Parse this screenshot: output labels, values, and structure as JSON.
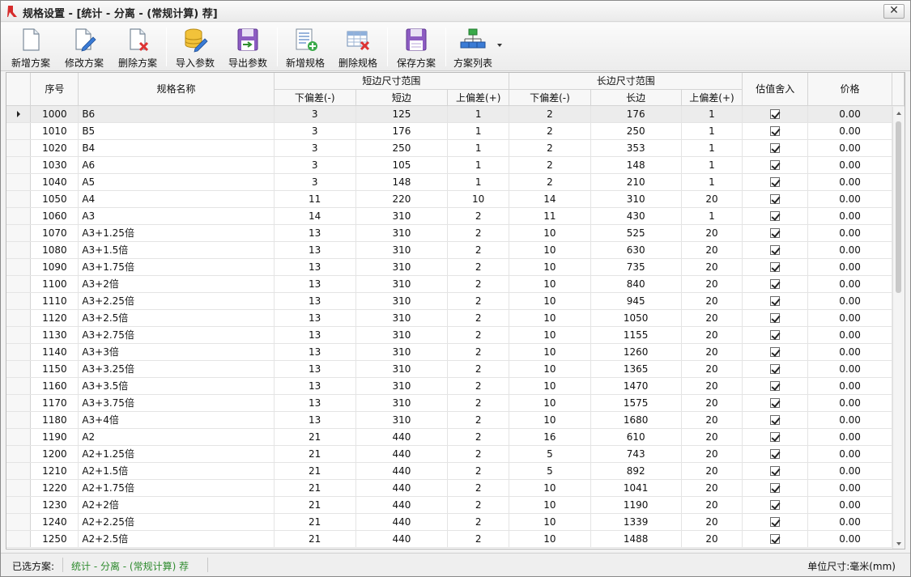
{
  "window": {
    "title": "规格设置 - [统计 - 分离 - (常规计算) 荐]",
    "close_glyph": "✕"
  },
  "toolbar": {
    "buttons": [
      {
        "label": "新增方案",
        "icon": "new-document-icon"
      },
      {
        "label": "修改方案",
        "icon": "edit-document-icon"
      },
      {
        "label": "删除方案",
        "icon": "delete-document-icon"
      },
      {
        "label": "导入参数",
        "icon": "database-import-icon"
      },
      {
        "label": "导出参数",
        "icon": "floppy-export-icon"
      },
      {
        "label": "新增规格",
        "icon": "add-spec-icon"
      },
      {
        "label": "删除规格",
        "icon": "delete-spec-icon"
      },
      {
        "label": "保存方案",
        "icon": "save-icon"
      },
      {
        "label": "方案列表",
        "icon": "hierarchy-list-icon"
      }
    ]
  },
  "grid": {
    "headers": {
      "seq": "序号",
      "name": "规格名称",
      "short_group": "短边尺寸范围",
      "long_group": "长边尺寸范围",
      "round": "估值舍入",
      "price": "价格",
      "lower": "下偏差(-)",
      "short": "短边",
      "long": "长边",
      "upper": "上偏差(+)"
    },
    "rows": [
      {
        "seq": "1000",
        "name": "B6",
        "s_low": "3",
        "s_val": "125",
        "s_up": "1",
        "l_low": "2",
        "l_val": "176",
        "l_up": "1",
        "round": true,
        "price": "0.00"
      },
      {
        "seq": "1010",
        "name": "B5",
        "s_low": "3",
        "s_val": "176",
        "s_up": "1",
        "l_low": "2",
        "l_val": "250",
        "l_up": "1",
        "round": true,
        "price": "0.00"
      },
      {
        "seq": "1020",
        "name": "B4",
        "s_low": "3",
        "s_val": "250",
        "s_up": "1",
        "l_low": "2",
        "l_val": "353",
        "l_up": "1",
        "round": true,
        "price": "0.00"
      },
      {
        "seq": "1030",
        "name": "A6",
        "s_low": "3",
        "s_val": "105",
        "s_up": "1",
        "l_low": "2",
        "l_val": "148",
        "l_up": "1",
        "round": true,
        "price": "0.00"
      },
      {
        "seq": "1040",
        "name": "A5",
        "s_low": "3",
        "s_val": "148",
        "s_up": "1",
        "l_low": "2",
        "l_val": "210",
        "l_up": "1",
        "round": true,
        "price": "0.00"
      },
      {
        "seq": "1050",
        "name": "A4",
        "s_low": "11",
        "s_val": "220",
        "s_up": "10",
        "l_low": "14",
        "l_val": "310",
        "l_up": "20",
        "round": true,
        "price": "0.00"
      },
      {
        "seq": "1060",
        "name": "A3",
        "s_low": "14",
        "s_val": "310",
        "s_up": "2",
        "l_low": "11",
        "l_val": "430",
        "l_up": "1",
        "round": true,
        "price": "0.00"
      },
      {
        "seq": "1070",
        "name": "A3+1.25倍",
        "s_low": "13",
        "s_val": "310",
        "s_up": "2",
        "l_low": "10",
        "l_val": "525",
        "l_up": "20",
        "round": true,
        "price": "0.00"
      },
      {
        "seq": "1080",
        "name": "A3+1.5倍",
        "s_low": "13",
        "s_val": "310",
        "s_up": "2",
        "l_low": "10",
        "l_val": "630",
        "l_up": "20",
        "round": true,
        "price": "0.00"
      },
      {
        "seq": "1090",
        "name": "A3+1.75倍",
        "s_low": "13",
        "s_val": "310",
        "s_up": "2",
        "l_low": "10",
        "l_val": "735",
        "l_up": "20",
        "round": true,
        "price": "0.00"
      },
      {
        "seq": "1100",
        "name": "A3+2倍",
        "s_low": "13",
        "s_val": "310",
        "s_up": "2",
        "l_low": "10",
        "l_val": "840",
        "l_up": "20",
        "round": true,
        "price": "0.00"
      },
      {
        "seq": "1110",
        "name": "A3+2.25倍",
        "s_low": "13",
        "s_val": "310",
        "s_up": "2",
        "l_low": "10",
        "l_val": "945",
        "l_up": "20",
        "round": true,
        "price": "0.00"
      },
      {
        "seq": "1120",
        "name": "A3+2.5倍",
        "s_low": "13",
        "s_val": "310",
        "s_up": "2",
        "l_low": "10",
        "l_val": "1050",
        "l_up": "20",
        "round": true,
        "price": "0.00"
      },
      {
        "seq": "1130",
        "name": "A3+2.75倍",
        "s_low": "13",
        "s_val": "310",
        "s_up": "2",
        "l_low": "10",
        "l_val": "1155",
        "l_up": "20",
        "round": true,
        "price": "0.00"
      },
      {
        "seq": "1140",
        "name": "A3+3倍",
        "s_low": "13",
        "s_val": "310",
        "s_up": "2",
        "l_low": "10",
        "l_val": "1260",
        "l_up": "20",
        "round": true,
        "price": "0.00"
      },
      {
        "seq": "1150",
        "name": "A3+3.25倍",
        "s_low": "13",
        "s_val": "310",
        "s_up": "2",
        "l_low": "10",
        "l_val": "1365",
        "l_up": "20",
        "round": true,
        "price": "0.00"
      },
      {
        "seq": "1160",
        "name": "A3+3.5倍",
        "s_low": "13",
        "s_val": "310",
        "s_up": "2",
        "l_low": "10",
        "l_val": "1470",
        "l_up": "20",
        "round": true,
        "price": "0.00"
      },
      {
        "seq": "1170",
        "name": "A3+3.75倍",
        "s_low": "13",
        "s_val": "310",
        "s_up": "2",
        "l_low": "10",
        "l_val": "1575",
        "l_up": "20",
        "round": true,
        "price": "0.00"
      },
      {
        "seq": "1180",
        "name": "A3+4倍",
        "s_low": "13",
        "s_val": "310",
        "s_up": "2",
        "l_low": "10",
        "l_val": "1680",
        "l_up": "20",
        "round": true,
        "price": "0.00"
      },
      {
        "seq": "1190",
        "name": "A2",
        "s_low": "21",
        "s_val": "440",
        "s_up": "2",
        "l_low": "16",
        "l_val": "610",
        "l_up": "20",
        "round": true,
        "price": "0.00"
      },
      {
        "seq": "1200",
        "name": "A2+1.25倍",
        "s_low": "21",
        "s_val": "440",
        "s_up": "2",
        "l_low": "5",
        "l_val": "743",
        "l_up": "20",
        "round": true,
        "price": "0.00"
      },
      {
        "seq": "1210",
        "name": "A2+1.5倍",
        "s_low": "21",
        "s_val": "440",
        "s_up": "2",
        "l_low": "5",
        "l_val": "892",
        "l_up": "20",
        "round": true,
        "price": "0.00"
      },
      {
        "seq": "1220",
        "name": "A2+1.75倍",
        "s_low": "21",
        "s_val": "440",
        "s_up": "2",
        "l_low": "10",
        "l_val": "1041",
        "l_up": "20",
        "round": true,
        "price": "0.00"
      },
      {
        "seq": "1230",
        "name": "A2+2倍",
        "s_low": "21",
        "s_val": "440",
        "s_up": "2",
        "l_low": "10",
        "l_val": "1190",
        "l_up": "20",
        "round": true,
        "price": "0.00"
      },
      {
        "seq": "1240",
        "name": "A2+2.25倍",
        "s_low": "21",
        "s_val": "440",
        "s_up": "2",
        "l_low": "10",
        "l_val": "1339",
        "l_up": "20",
        "round": true,
        "price": "0.00"
      },
      {
        "seq": "1250",
        "name": "A2+2.5倍",
        "s_low": "21",
        "s_val": "440",
        "s_up": "2",
        "l_low": "10",
        "l_val": "1488",
        "l_up": "20",
        "round": true,
        "price": "0.00"
      }
    ],
    "selected_row": 0
  },
  "statusbar": {
    "selected_label": "已选方案:",
    "scheme": "统计 - 分离 - (常规计算) 荐",
    "unit": "单位尺寸:毫米(mm)"
  },
  "colors": {
    "scheme_text": "#2e8b2e",
    "app_icon_red": "#d62b2b"
  }
}
